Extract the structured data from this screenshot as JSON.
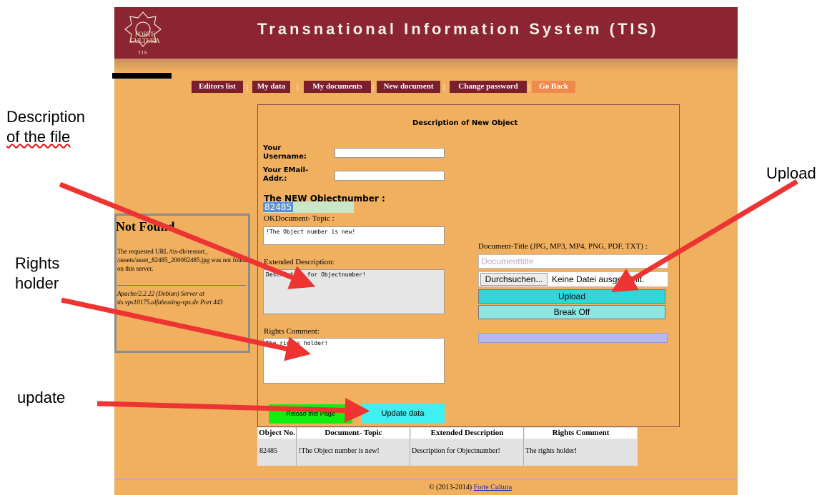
{
  "header": {
    "title": "Transnational Information System (TIS)",
    "logo_line1": "FORTE",
    "logo_line2": "CULTURA",
    "logo_tis": "TIS"
  },
  "nav": {
    "items": [
      {
        "label": "Editors list"
      },
      {
        "label": "My data"
      },
      {
        "label": "My documents"
      },
      {
        "label": "New document"
      },
      {
        "label": "Change password"
      },
      {
        "label": "Go Back"
      }
    ],
    "separator": "|"
  },
  "form": {
    "title": "Description of New Object",
    "username_label": "Your Username:",
    "email_label": "Your EMail-Addr.:",
    "objnum_label": "The NEW Objectnumber :",
    "objnum_value": "82485",
    "topic_label": "OKDocument- Topic :",
    "topic_value": "!The Object number is new!",
    "ext_desc_label": "Extended Description:",
    "ext_desc_value": "Description for Objectnumber!",
    "rights_label": "Rights Comment:",
    "rights_value": "The rights holder!",
    "reload_label": "Reload this Page",
    "update_label": "Update data"
  },
  "upload": {
    "doc_title_label": "Document-Title (JPG, MP3, MP4, PNG, PDF, TXT) :",
    "doc_title_placeholder": "Documenttitle",
    "browse_label": "Durchsuchen...",
    "file_status": "Keine Datei ausgewählt.",
    "upload_label": "Upload",
    "break_label": "Break Off"
  },
  "not_found": {
    "title": "Not Found",
    "message": "The requested URL /tis-db/ressort_ /assets/asset_82485_200082485.jpg was not found on this server.",
    "server": "Apache/2.2.22 (Debian) Server at tis.vps10175.alfahosting-vps.de Port 443"
  },
  "table": {
    "headers": [
      "Object No.",
      "Document- Topic",
      "Extended Description",
      "Rights Comment"
    ],
    "row": [
      "82485",
      "!The Object number is new!",
      "Description for Objectnumber!",
      "The rights holder!"
    ]
  },
  "footer": {
    "copyright": "© (2013-2014)",
    "link": "Forte Cultura"
  },
  "annotations": {
    "description_line1": "Description",
    "description_line2": "of the file",
    "rights_line1": "Rights",
    "rights_line2": "holder",
    "update": "update",
    "upload": "Upload"
  },
  "colors": {
    "header": "#8a2531",
    "page": "#f0b060",
    "nav": "#7b1f2d",
    "go_back": "#f08a4c",
    "upload": "#2cd8da",
    "update": "#40f0f0",
    "reload": "#10f010",
    "arrow": "#ee3333"
  }
}
